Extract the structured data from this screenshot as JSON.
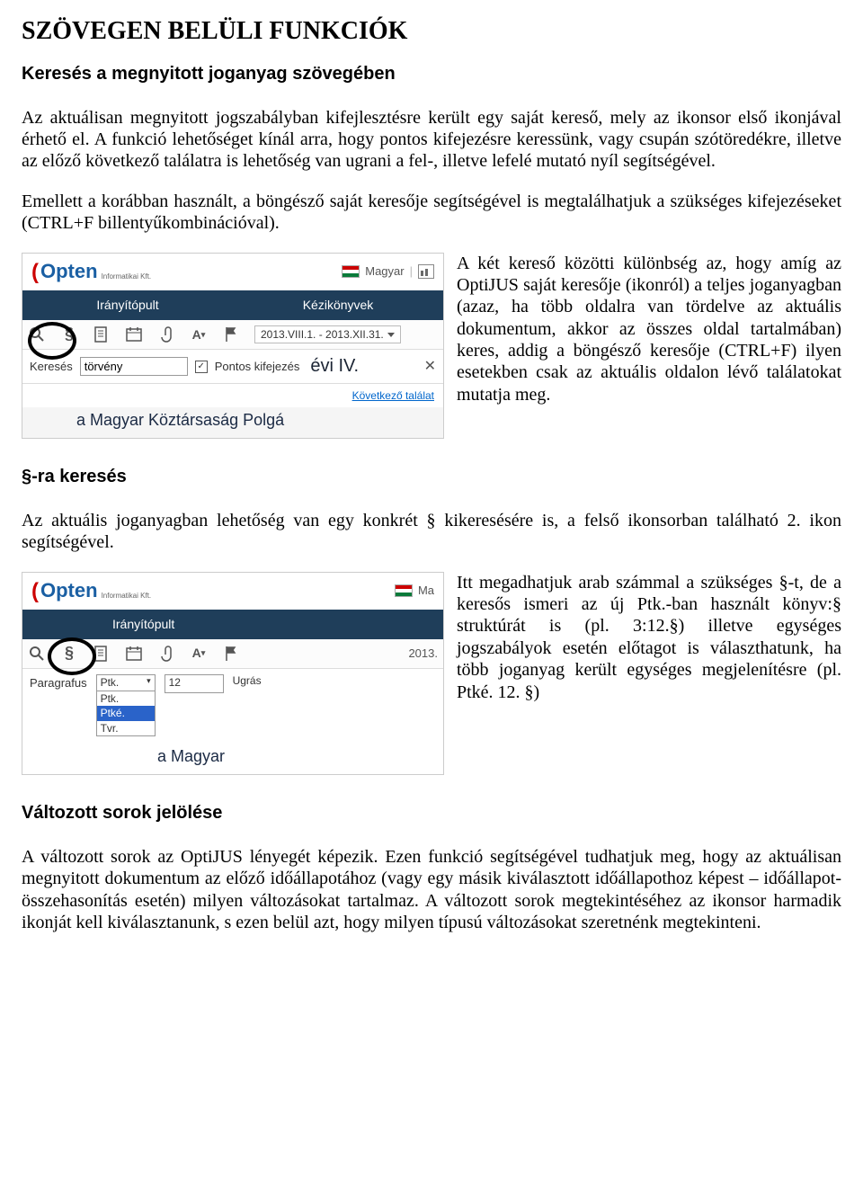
{
  "title": "SZÖVEGEN BELÜLI FUNKCIÓK",
  "section1": {
    "heading": "Keresés a megnyitott joganyag szövegében",
    "p1": "Az aktuálisan megnyitott jogszabályban kifejlesztésre került egy saját kereső, mely az ikonsor első ikonjával érhető el. A funkció lehetőséget kínál arra, hogy pontos kifejezésre keressünk, vagy csupán szótöredékre, illetve az előző következő találatra is lehetőség van ugrani a fel-, illetve lefelé mutató nyíl segítségével.",
    "p2": "Emellett a korábban használt, a böngésző saját keresője segítségével is megtalálhatjuk a szükséges kifejezéseket (CTRL+F billentyűkombinációval).",
    "aside": "A két kereső közötti különbség az, hogy amíg az OptiJUS saját keresője (ikonról) a teljes joganyagban (azaz, ha  több oldalra van tördelve az aktuális dokumentum, akkor az összes oldal tartalmában) keres, addig a böngésző keresője (CTRL+F) ilyen esetekben csak az aktuális oldalon lévő találatokat mutatja meg."
  },
  "sshotA": {
    "brand": "Opten",
    "brand_sub": "Informatikai Kft.",
    "lang_label": "Magyar",
    "nav1": "Irányítópult",
    "nav2": "Kézikönyvek",
    "date_range": "2013.VIII.1. - 2013.XII.31.",
    "search_label": "Keresés",
    "search_value": "törvény",
    "exact_label": "Pontos kifejezés",
    "evi_frag": "évi IV.",
    "next_hit": "Következő találat",
    "result_line": "a Magyar Köztársaság Polgá"
  },
  "section2": {
    "heading": "§-ra keresés",
    "p1": "Az aktuális joganyagban lehetőség van egy konkrét § kikeresésére is, a felső ikonsorban található 2. ikon segítségével.",
    "aside": "Itt megadhatjuk arab számmal a szükséges §-t, de a keresős ismeri az új Ptk.-ban használt könyv:§ struktúrát is (pl. 3:12.§) illetve egységes jogszabályok esetén előtagot is választhatunk, ha több joganyag került egységes megjelenítésre (pl. Ptké. 12. §)"
  },
  "sshotB": {
    "brand": "Opten",
    "brand_sub": "Informatikai Kft.",
    "lang_frag": "Ma",
    "nav1": "Irányítópult",
    "date_frag": "2013.",
    "para_label": "Paragrafus",
    "sel_top": "Ptk.",
    "opts": [
      "Ptk.",
      "Ptké.",
      "Tvr."
    ],
    "num": "12",
    "ugras": "Ugrás",
    "magyar": "a Magyar"
  },
  "section3": {
    "heading": "Változott sorok jelölése",
    "p1": "A változott sorok az OptiJUS lényegét képezik. Ezen funkció segítségével tudhatjuk meg, hogy az aktuálisan megnyitott dokumentum az előző időállapotához (vagy egy másik kiválasztott időállapothoz képest – időállapot-összehasonítás esetén) milyen változásokat tartalmaz. A változott sorok megtekintéséhez az ikonsor harmadik ikonját kell kiválasztanunk, s ezen belül azt, hogy milyen típusú változásokat szeretnénk megtekinteni."
  }
}
